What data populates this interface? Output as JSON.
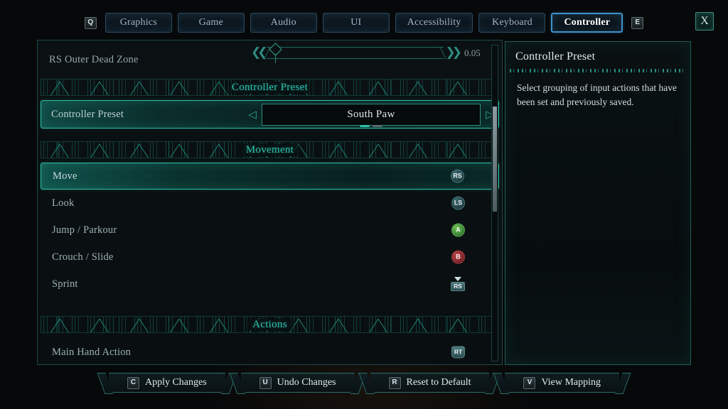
{
  "tabs": {
    "prev_key": "Q",
    "next_key": "E",
    "items": [
      {
        "label": "Graphics",
        "active": false
      },
      {
        "label": "Game",
        "active": false
      },
      {
        "label": "Audio",
        "active": false
      },
      {
        "label": "UI",
        "active": false
      },
      {
        "label": "Accessibility",
        "active": false
      },
      {
        "label": "Keyboard",
        "active": false
      },
      {
        "label": "Controller",
        "active": true
      }
    ]
  },
  "close_button": {
    "label": "X"
  },
  "settings": {
    "slider_row": {
      "label": "RS Outer Dead Zone",
      "value": "0.05"
    },
    "sections": [
      {
        "title": "Controller Preset",
        "preset_row": {
          "label": "Controller Preset",
          "value": "South Paw",
          "left_arrow": "◁",
          "right_arrow": "▷",
          "page_count": 2,
          "page_active": 0
        }
      },
      {
        "title": "Movement",
        "bindings": [
          {
            "label": "Move",
            "badge": "RS",
            "badge_type": "stick",
            "press": false,
            "selected": true
          },
          {
            "label": "Look",
            "badge": "LS",
            "badge_type": "stick",
            "press": false,
            "selected": false
          },
          {
            "label": "Jump / Parkour",
            "badge": "A",
            "badge_type": "a",
            "press": false,
            "selected": false
          },
          {
            "label": "Crouch / Slide",
            "badge": "B",
            "badge_type": "b",
            "press": false,
            "selected": false
          },
          {
            "label": "Sprint",
            "badge": "RS",
            "badge_type": "stick-sq",
            "press": true,
            "selected": false
          }
        ]
      },
      {
        "title": "Actions",
        "bindings": [
          {
            "label": "Main Hand Action",
            "badge": "RT",
            "badge_type": "trigger",
            "press": false,
            "selected": false
          }
        ]
      }
    ]
  },
  "info_panel": {
    "title": "Controller Preset",
    "body": "Select grouping of input actions that have been set and previously saved."
  },
  "bottom_bar": {
    "buttons": [
      {
        "key": "C",
        "label": "Apply Changes"
      },
      {
        "key": "U",
        "label": "Undo Changes"
      },
      {
        "key": "R",
        "label": "Reset to Default"
      },
      {
        "key": "V",
        "label": "View Mapping"
      }
    ]
  },
  "colors": {
    "accent_teal": "#2fc0aa",
    "accent_blue": "#3f93c8",
    "panel_border": "#1c4a46",
    "text_primary": "#e2ecee",
    "text_muted": "#9db0b7"
  }
}
